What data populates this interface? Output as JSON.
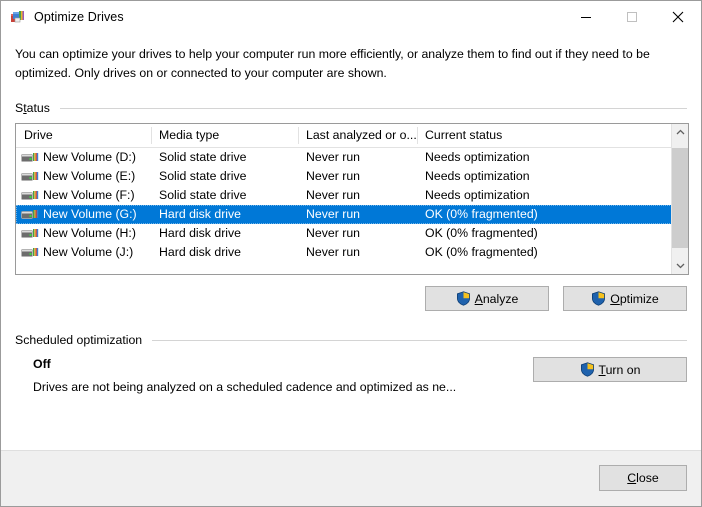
{
  "window": {
    "title": "Optimize Drives",
    "icon": "defrag-icon",
    "controls": {
      "minimize": "minimize-icon",
      "maximize": "maximize-icon",
      "close": "close-icon"
    }
  },
  "intro": "You can optimize your drives to help your computer run more efficiently, or analyze them to find out if they need to be optimized. Only drives on or connected to your computer are shown.",
  "status_section": {
    "label_pre": "S",
    "label_accel": "t",
    "label_post": "atus",
    "columns": [
      "Drive",
      "Media type",
      "Last analyzed or o...",
      "Current status"
    ],
    "rows": [
      {
        "drive": "New Volume (D:)",
        "media": "Solid state drive",
        "last": "Never run",
        "status": "Needs optimization",
        "selected": false
      },
      {
        "drive": "New Volume (E:)",
        "media": "Solid state drive",
        "last": "Never run",
        "status": "Needs optimization",
        "selected": false
      },
      {
        "drive": "New Volume (F:)",
        "media": "Solid state drive",
        "last": "Never run",
        "status": "Needs optimization",
        "selected": false
      },
      {
        "drive": "New Volume (G:)",
        "media": "Hard disk drive",
        "last": "Never run",
        "status": "OK (0% fragmented)",
        "selected": true
      },
      {
        "drive": "New Volume (H:)",
        "media": "Hard disk drive",
        "last": "Never run",
        "status": "OK (0% fragmented)",
        "selected": false
      },
      {
        "drive": "New Volume (J:)",
        "media": "Hard disk drive",
        "last": "Never run",
        "status": "OK (0% fragmented)",
        "selected": false
      }
    ],
    "scrollbar": {
      "up": "chevron-up-icon",
      "down": "chevron-down-icon"
    },
    "buttons": {
      "analyze": {
        "accel": "A",
        "rest": "nalyze",
        "icon": "uac-shield-icon"
      },
      "optimize": {
        "accel": "O",
        "rest": "ptimize",
        "icon": "uac-shield-icon"
      }
    }
  },
  "scheduled_section": {
    "label": "Scheduled optimization",
    "state": "Off",
    "description": "Drives are not being analyzed on a scheduled cadence and optimized as ne...",
    "turn_on": {
      "accel": "T",
      "rest": "urn on",
      "icon": "uac-shield-icon"
    }
  },
  "footer": {
    "close": {
      "accel": "C",
      "rest": "lose"
    }
  },
  "colors": {
    "selection": "#0078d7",
    "button_face": "#e1e1e1",
    "button_border": "#adadad",
    "footer_bg": "#f0f0f0",
    "shield_blue": "#1f62ad",
    "shield_gold": "#f5c11e"
  }
}
